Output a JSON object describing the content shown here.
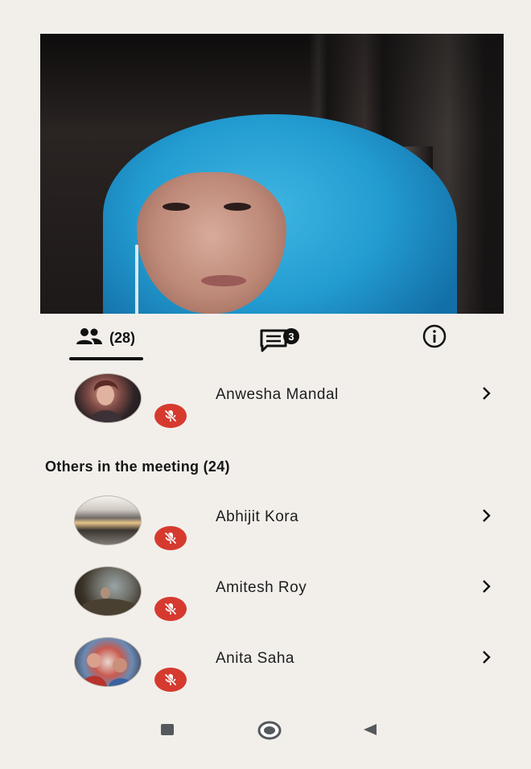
{
  "tabs": {
    "participants_count": "(28)",
    "chat_badge": "3"
  },
  "host": {
    "name": "Anwesha Mandal"
  },
  "others": {
    "title": "Others in the meeting (24)",
    "items": [
      {
        "name": "Abhijit Kora"
      },
      {
        "name": "Amitesh Roy"
      },
      {
        "name": "Anita Saha"
      }
    ]
  },
  "colors": {
    "mute_red": "#d63a2f",
    "text_dark": "#1b1b1b",
    "background": "#f2efeb"
  },
  "icons": {
    "participants": "people-icon",
    "chat": "chat-icon",
    "info": "info-icon",
    "muted": "mic-off-icon",
    "chevron": "chevron-right-icon",
    "nav_recents": "square-icon",
    "nav_home": "circle-icon",
    "nav_back": "triangle-back-icon"
  }
}
